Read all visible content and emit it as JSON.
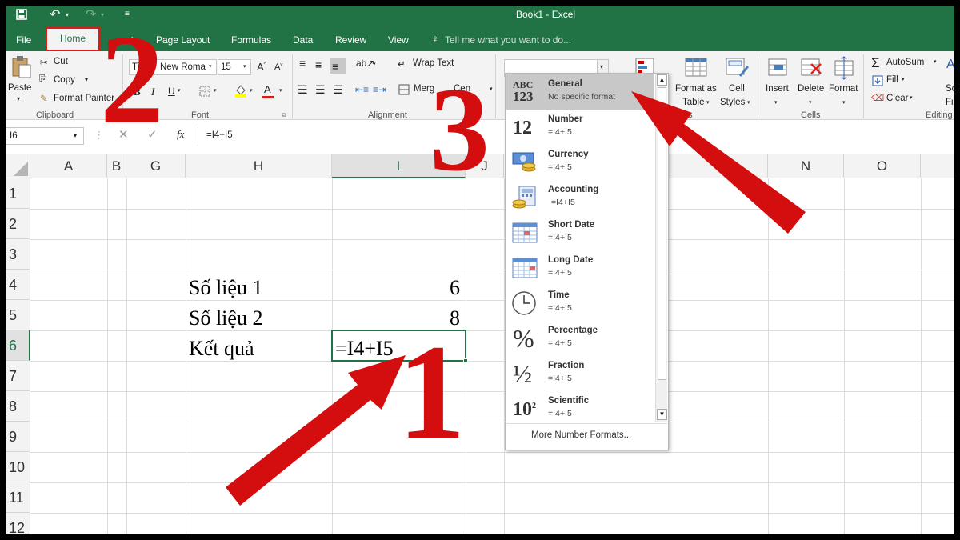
{
  "title": "Book1 - Excel",
  "tabs": [
    "File",
    "Home",
    "Insert",
    "Page Layout",
    "Formulas",
    "Data",
    "Review",
    "View"
  ],
  "tab_visible": [
    "File",
    "Home",
    "ert",
    "Page Layout",
    "Formulas",
    "Data",
    "Review",
    "View"
  ],
  "tell_me": "Tell me what you want to do...",
  "clipboard": {
    "paste": "Paste",
    "cut": "Cut",
    "copy": "Copy",
    "format_painter": "Format Painter",
    "group": "Clipboard"
  },
  "font": {
    "name": "Times New Roma",
    "name_visible": "Ti",
    "name_visible2": "New Roma",
    "size": "15",
    "group": "Font"
  },
  "alignment": {
    "wrap": "Wrap Text",
    "merge": "Merge & Center",
    "merge_visible": "Merg",
    "center_visible": "Cen",
    "group": "Alignment"
  },
  "styles": {
    "l": "l",
    "format_as_table": "Format as",
    "table": "Table",
    "cell": "Cell",
    "styles": "Styles",
    "group": "es"
  },
  "cells": {
    "insert": "Insert",
    "delete": "Delete",
    "format": "Format",
    "group": "Cells"
  },
  "editing": {
    "autosum": "AutoSum",
    "fill": "Fill",
    "clear": "Clear",
    "sort": "Sc",
    "find": "Fi",
    "group": "Editing"
  },
  "number_format_value": "",
  "formula_bar": {
    "name_box": "I6",
    "fx": "fx",
    "formula": "=I4+I5"
  },
  "columns": [
    "A",
    "B",
    "G",
    "H",
    "I",
    "J",
    "N",
    "O"
  ],
  "rows": [
    "1",
    "2",
    "3",
    "4",
    "5",
    "6",
    "7",
    "8",
    "9",
    "10",
    "11",
    "12"
  ],
  "cells_data": {
    "h4": "Số liệu 1",
    "i4": "6",
    "h5": "Số liệu 2",
    "i5": "8",
    "h6": "Kết quả",
    "i6": "=I4+I5"
  },
  "dropdown": {
    "items": [
      {
        "name": "General",
        "desc": "No specific format",
        "icon": "abc-123-icon"
      },
      {
        "name": "Number",
        "desc": "=I4+I5",
        "icon": "number-12-icon"
      },
      {
        "name": "Currency",
        "desc": "=I4+I5",
        "icon": "currency-icon"
      },
      {
        "name": "Accounting",
        "desc": "=I4+I5",
        "icon": "accounting-icon"
      },
      {
        "name": "Short Date",
        "desc": "=I4+I5",
        "icon": "calendar-icon"
      },
      {
        "name": "Long Date",
        "desc": "=I4+I5",
        "icon": "calendar-icon"
      },
      {
        "name": "Time",
        "desc": "=I4+I5",
        "icon": "clock-icon"
      },
      {
        "name": "Percentage",
        "desc": "=I4+I5",
        "icon": "percent-icon"
      },
      {
        "name": "Fraction",
        "desc": "=I4+I5",
        "icon": "fraction-icon"
      },
      {
        "name": "Scientific",
        "desc": "=I4+I5",
        "icon": "scientific-icon"
      }
    ],
    "more": "More Number Formats..."
  },
  "annotations": {
    "one": "1",
    "two": "2",
    "three": "3"
  },
  "colors": {
    "excel_green": "#217346",
    "arrow_red": "#d40e0e",
    "selected_item": "#c8c8c8"
  }
}
